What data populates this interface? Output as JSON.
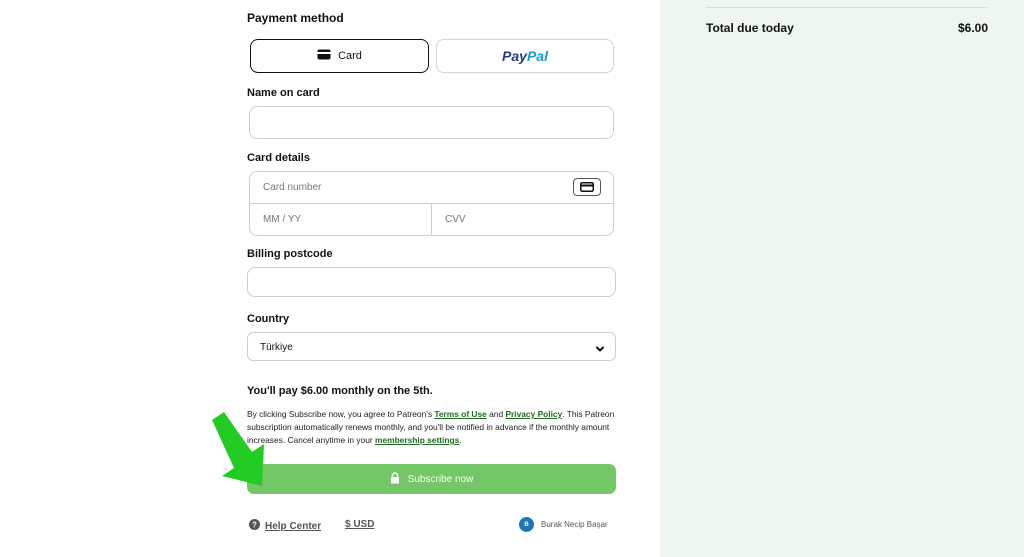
{
  "payment": {
    "title": "Payment method",
    "card_label": "Card",
    "paypal_pay": "Pay",
    "paypal_pal": "Pal"
  },
  "name_on_card": {
    "label": "Name on card",
    "value": ""
  },
  "card_details": {
    "label": "Card details",
    "number_placeholder": "Card number",
    "expiry_placeholder": "MM / YY",
    "cvv_placeholder": "CVV"
  },
  "billing": {
    "label": "Billing postcode",
    "value": ""
  },
  "country": {
    "label": "Country",
    "value": "Türkiye"
  },
  "summary": {
    "text": "You'll pay $6.00 monthly on the 5th."
  },
  "legal": {
    "t1": "By clicking Subscribe now, you agree to Patreon's ",
    "terms": "Terms of Use",
    "t2": " and ",
    "privacy": "Privacy Policy",
    "t3": ". This Patreon subscription automatically renews monthly, and you'll be notified in advance if the monthly amount increases. Cancel anytime in your ",
    "settings": "membership settings",
    "t4": "."
  },
  "subscribe": {
    "label": "Subscribe now"
  },
  "footer": {
    "help": "Help Center",
    "currency": "$ USD",
    "user_initial": "B",
    "user_name": "Burak Necip Başar"
  },
  "order": {
    "total_label": "Total due today",
    "total_value": "$6.00"
  },
  "colors": {
    "accent_green": "#74c766",
    "link_green": "#1f6b1f",
    "panel_bg": "#eef7ee",
    "arrow_green": "#22cc22"
  }
}
